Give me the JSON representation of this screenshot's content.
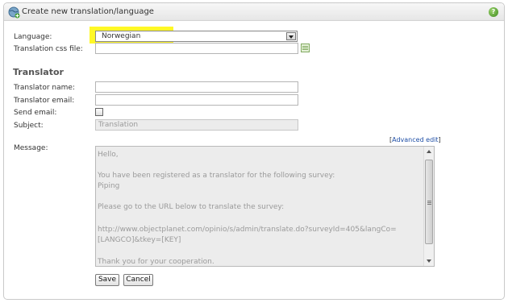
{
  "dialog": {
    "title": "Create new translation/language",
    "title_icon": "globe-add-icon",
    "help_icon": "help-icon"
  },
  "form": {
    "language_label": "Language:",
    "language_value": "Norwegian",
    "css_file_label": "Translation css file:",
    "css_file_value": "",
    "css_browse_icon": "file-browse-icon",
    "translator_heading": "Translator",
    "translator_name_label": "Translator name:",
    "translator_name_value": "",
    "translator_email_label": "Translator email:",
    "translator_email_value": "",
    "send_email_label": "Send email:",
    "send_email_checked": false,
    "subject_label": "Subject:",
    "subject_value": "Translation",
    "advanced_edit_prefix": "[",
    "advanced_edit_link": "Advanced edit",
    "advanced_edit_suffix": "]",
    "message_label": "Message:",
    "message_lines": [
      "Hello,",
      "",
      "You have been registered as a translator for the following survey:",
      "Piping",
      "",
      "Please go to the URL below to translate the survey:",
      "",
      " http://www.objectplanet.com/opinio/s/admin/translate.do?surveyId=405&langCo=",
      "[LANGCO]&tkey=[KEY]",
      "",
      "Thank you for your cooperation."
    ]
  },
  "buttons": {
    "save": "Save",
    "cancel": "Cancel"
  },
  "colors": {
    "highlight": "#fff700",
    "link": "#1f4fa6",
    "help_green": "#3d8a1d"
  }
}
